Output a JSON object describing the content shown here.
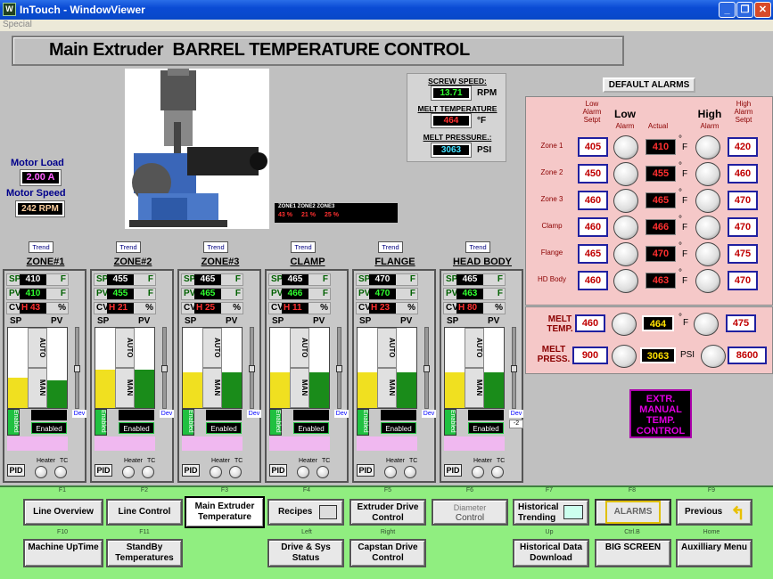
{
  "window": {
    "title": "InTouch - WindowViewer",
    "menu": "Special",
    "icon": "W"
  },
  "page_title": "Main Extruder  BARREL TEMPERATURE CONTROL",
  "motor": {
    "load_label": "Motor Load",
    "load_value": "2.00 A",
    "speed_label": "Motor Speed",
    "speed_value": "242 RPM"
  },
  "zone_strip": {
    "labels": "ZONE1 ZONE2 ZONE3",
    "values": [
      "43 %",
      "21 %",
      "25 %"
    ]
  },
  "screw": {
    "speed_label": "SCREW SPEED:",
    "speed_value": "13.71",
    "speed_unit": "RPM",
    "melt_temp_label": "MELT TEMPERATURE",
    "melt_temp_value": "464",
    "melt_temp_unit": "°F",
    "melt_press_label": "MELT PRESSURE.:",
    "melt_press_value": "3063",
    "melt_press_unit": "PSI"
  },
  "controllers": [
    {
      "name": "ZONE#1",
      "trend": "Trend",
      "sp": "410",
      "pv": "410",
      "cv": "H 43",
      "sp_fill": 0.38,
      "pv_fill": 0.35
    },
    {
      "name": "ZONE#2",
      "trend": "Trend",
      "sp": "455",
      "pv": "455",
      "cv": "H 21",
      "sp_fill": 0.48,
      "pv_fill": 0.48
    },
    {
      "name": "ZONE#3",
      "trend": "Trend",
      "sp": "465",
      "pv": "465",
      "cv": "H 25",
      "sp_fill": 0.45,
      "pv_fill": 0.45
    },
    {
      "name": "CLAMP",
      "trend": "Trend",
      "sp": "465",
      "pv": "466",
      "cv": "H 11",
      "sp_fill": 0.45,
      "pv_fill": 0.45
    },
    {
      "name": "FLANGE",
      "trend": "Trend",
      "sp": "470",
      "pv": "470",
      "cv": "H 23",
      "sp_fill": 0.45,
      "pv_fill": 0.45
    },
    {
      "name": "HEAD BODY",
      "trend": "Trend",
      "sp": "465",
      "pv": "463",
      "cv": "H 80",
      "sp_fill": 0.45,
      "pv_fill": 0.45
    }
  ],
  "faceplate_labels": {
    "sp": "SP",
    "pv": "PV",
    "cv": "CV",
    "unit_f": "F",
    "unit_pct": "%",
    "auto": "AUTO",
    "man": "MAN",
    "enabled_side": "Enabled",
    "enabled": "Enabled",
    "dev": "Dev",
    "dev_value": "-2",
    "pid": "PID",
    "heater": "Heater",
    "tc": "TC"
  },
  "alarms": {
    "default_button": "DEFAULT ALARMS",
    "header_low_setpt": "Low Alarm Setpt",
    "header_low": "Low",
    "header_low_alarm": "Alarm",
    "header_actual": "Actual",
    "header_high": "High",
    "header_high_alarm": "Alarm",
    "header_high_setpt": "High Alarm Setpt",
    "rows": [
      {
        "zone": "Zone 1",
        "low": "405",
        "actual": "410",
        "high": "420"
      },
      {
        "zone": "Zone 2",
        "low": "450",
        "actual": "455",
        "high": "460"
      },
      {
        "zone": "Zone 3",
        "low": "460",
        "actual": "465",
        "high": "470"
      },
      {
        "zone": "Clamp",
        "low": "460",
        "actual": "466",
        "high": "470"
      },
      {
        "zone": "Flange",
        "low": "465",
        "actual": "470",
        "high": "475"
      },
      {
        "zone": "HD Body",
        "low": "460",
        "actual": "463",
        "high": "470"
      }
    ],
    "unit_f": "F",
    "deg": "°",
    "melt_temp_label": "MELT TEMP.",
    "melt_temp_low": "460",
    "melt_temp_actual": "464",
    "melt_temp_high": "475",
    "melt_press_label": "MELT PRESS.",
    "melt_press_low": "900",
    "melt_press_actual": "3063",
    "melt_press_unit": "PSI",
    "melt_press_high": "8600"
  },
  "extr_button": "EXTR. MANUAL TEMP. CONTROL",
  "nav": {
    "f1": "F1",
    "line_overview": "Line Overview",
    "f2": "F2",
    "line_control": "Line Control",
    "f3": "F3",
    "main_extruder": "Main Extruder Temperature",
    "f4": "F4",
    "recipes": "Recipes",
    "f5": "F5",
    "extruder_drive": "Extruder Drive Control",
    "f6": "F6",
    "diameter": "Diameter",
    "diameter_control": "Control",
    "f7": "F7",
    "historical_trending": "Historical Trending",
    "f8": "F8",
    "alarms": "ALARMS",
    "f9": "F9",
    "previous": "Previous",
    "f10": "F10",
    "machine_uptime": "Machine UpTime",
    "f11": "F11",
    "standby": "StandBy Temperatures",
    "left": "Left",
    "drive_sys": "Drive & Sys Status",
    "right": "Right",
    "capstan": "Capstan Drive Control",
    "up": "Up",
    "historical_download": "Historical Data Download",
    "ctrlb": "Ctrl.B",
    "big_screen": "BIG SCREEN",
    "home": "Home",
    "aux_menu": "Auxilliary Menu"
  },
  "colors": {
    "sp_bar": "#f0e020",
    "pv_bar": "#1a8c1a",
    "panel_pink": "#f5c8c8",
    "nav_green": "#90ee80",
    "extr_magenta": "#e000e0"
  }
}
